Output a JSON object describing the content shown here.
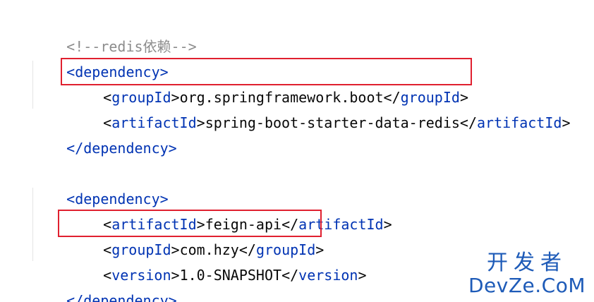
{
  "code": {
    "comment": "<!--redis依赖-->",
    "dep1": {
      "open": "<dependency>",
      "group_lt": "<",
      "group_tag": "groupId",
      "group_gt": ">",
      "group_value": "org.springframework.boot",
      "group_close_lt": "</",
      "group_close_tag": "groupId",
      "group_close_gt": ">",
      "artifact_lt": "<",
      "artifact_tag": "artifactId",
      "artifact_gt": ">",
      "artifact_value": "spring-boot-starter-data-redis",
      "artifact_close_lt": "</",
      "artifact_close_tag": "artifactId",
      "artifact_close_gt": ">",
      "close": "</dependency>"
    },
    "dep2": {
      "open": "<dependency>",
      "artifact_lt": "<",
      "artifact_tag": "artifactId",
      "artifact_gt": ">",
      "artifact_value": "feign-api",
      "artifact_close_lt": "</",
      "artifact_close_tag": "artifactId",
      "artifact_close_gt": ">",
      "group_lt": "<",
      "group_tag": "groupId",
      "group_gt": ">",
      "group_value": "com.hzy",
      "group_close_lt": "</",
      "group_close_tag": "groupId",
      "group_close_gt": ">",
      "version_lt": "<",
      "version_tag": "version",
      "version_gt": ">",
      "version_value": "1.0-SNAPSHOT",
      "version_close_lt": "</",
      "version_close_tag": "version",
      "version_close_gt": ">",
      "close": "</dependency>"
    }
  },
  "watermark": {
    "line1": "开发者",
    "line2": "DevZe.CoM"
  },
  "colors": {
    "tag": "#0033b3",
    "text": "#080808",
    "comment": "#8c8c8c",
    "highlight": "#e0202f",
    "watermark": "#1e5bb8"
  }
}
